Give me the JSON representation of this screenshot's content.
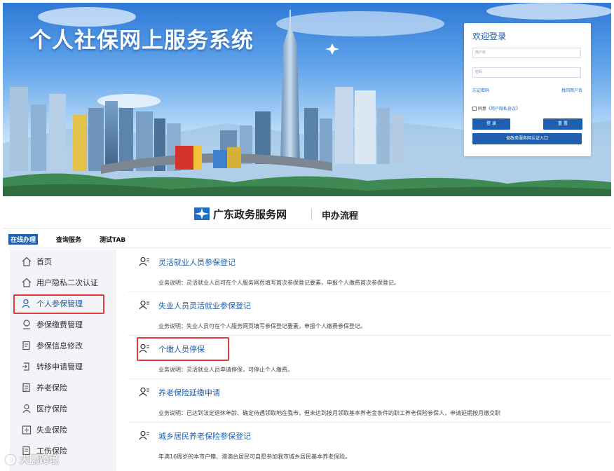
{
  "banner": {
    "system_title": "个人社保网上服务系统"
  },
  "login": {
    "title": "欢迎登录",
    "username_placeholder": "用户名",
    "password_placeholder": "密码",
    "forgot_password": "忘记密码",
    "recover_username": "找回用户名",
    "agree_label": "同意",
    "policy_link": "《用户隐私协议》",
    "login_button": "登 录",
    "reset_button": "重 置",
    "gov_auth_button": "省政务服务网认证入口"
  },
  "header": {
    "site_name": "广东政务服务网",
    "process_label": "申办流程"
  },
  "tabs": [
    {
      "label": "在线办理",
      "active": true
    },
    {
      "label": "查询服务",
      "active": false
    },
    {
      "label": "测试TAB",
      "active": false
    }
  ],
  "sidebar": {
    "items": [
      {
        "label": "首页",
        "icon": "home-icon"
      },
      {
        "label": "用户隐私二次认证",
        "icon": "home-icon"
      },
      {
        "label": "个人参保管理",
        "icon": "person-icon",
        "active": true
      },
      {
        "label": "参保缴费管理",
        "icon": "payment-icon"
      },
      {
        "label": "参保信息修改",
        "icon": "edit-icon"
      },
      {
        "label": "转移申请管理",
        "icon": "transfer-icon"
      },
      {
        "label": "养老保险",
        "icon": "document-icon"
      },
      {
        "label": "医疗保险",
        "icon": "medical-person-icon"
      },
      {
        "label": "失业保险",
        "icon": "building-icon"
      },
      {
        "label": "工伤保险",
        "icon": "document-icon"
      }
    ]
  },
  "services": [
    {
      "title": "灵活就业人员参保登记",
      "desc": "业务说明：灵活就业人员可在个人服务网页填写首次参保登记要素，申报个人缴费首次参保登记。"
    },
    {
      "title": "失业人员灵活就业参保登记",
      "desc": "业务说明：失业人员可在个人服务网页填写参保登记要素，申报个人缴费参保登记。"
    },
    {
      "title": "个缴人员停保",
      "desc": "业务说明：灵活就业人员申请停保，可停止个人缴费。"
    },
    {
      "title": "养老保险延缴申请",
      "desc": "业务说明：已达到法定退休年龄、确定待遇领取地在我市，但未达到按月领取基本养老金条件的职工养老保险参保人，申请延期按月缴交职"
    },
    {
      "title": "城乡居民养老保险参保登记",
      "desc": "年满16周岁的本市户籍、港澳台居民可自愿参加我市城乡居民基本养老保险。"
    }
  ],
  "watermark": "大鹏跨境",
  "colors": {
    "primary_blue": "#1f5fb0",
    "highlight_red": "#e23b3b",
    "sidebar_bg": "#f2f4f7"
  }
}
